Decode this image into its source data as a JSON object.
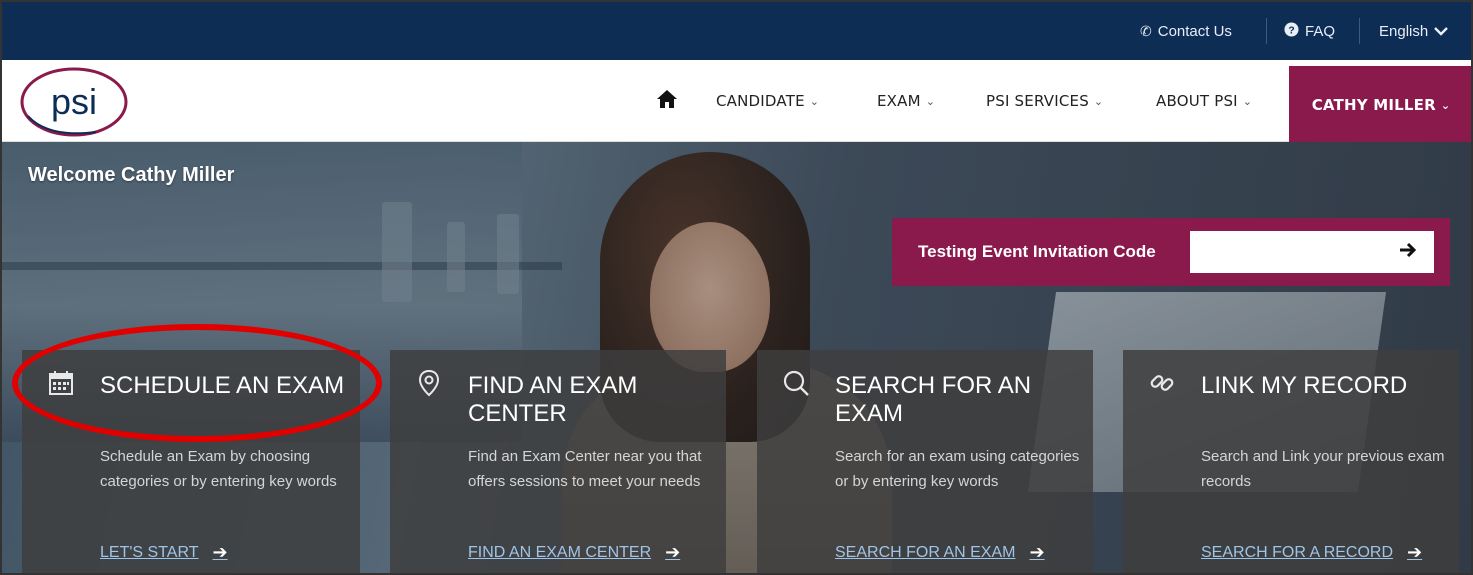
{
  "topbar": {
    "contact_label": "Contact Us",
    "contact_icon": "phone-icon",
    "faq_label": "FAQ",
    "faq_icon": "question-circle-icon",
    "language_label": "English",
    "language_icon": "chevron-down-icon"
  },
  "nav": {
    "logo_text": "psi",
    "home_icon": "home-icon",
    "items": [
      {
        "label": "CANDIDATE"
      },
      {
        "label": "EXAM"
      },
      {
        "label": "PSI SERVICES"
      },
      {
        "label": "ABOUT PSI"
      }
    ],
    "user_label": "CATHY MILLER"
  },
  "hero": {
    "welcome": "Welcome Cathy Miller",
    "invite_label": "Testing Event Invitation Code",
    "invite_value": "",
    "invite_submit_icon": "arrow-right-icon"
  },
  "cards": [
    {
      "title": "SCHEDULE AN EXAM",
      "description": "Schedule an Exam by choosing categories or by entering key words",
      "link": "LET'S START",
      "icon": "calendar-icon"
    },
    {
      "title": "FIND AN EXAM CENTER",
      "description": "Find an Exam Center near you that offers sessions to meet your needs",
      "link": "FIND AN EXAM CENTER",
      "icon": "map-pin-icon"
    },
    {
      "title": "SEARCH FOR AN EXAM",
      "description": "Search for an exam using categories or by entering key words",
      "link": "SEARCH FOR AN EXAM",
      "icon": "search-icon"
    },
    {
      "title": "LINK MY RECORD",
      "description": "Search and Link your previous exam records",
      "link": "SEARCH FOR A RECORD",
      "icon": "link-icon"
    }
  ],
  "colors": {
    "topbar": "#0e2d55",
    "brand_maroon": "#8a1a4b",
    "highlight_red": "#e00000",
    "link_blue": "#9fc4e8"
  }
}
